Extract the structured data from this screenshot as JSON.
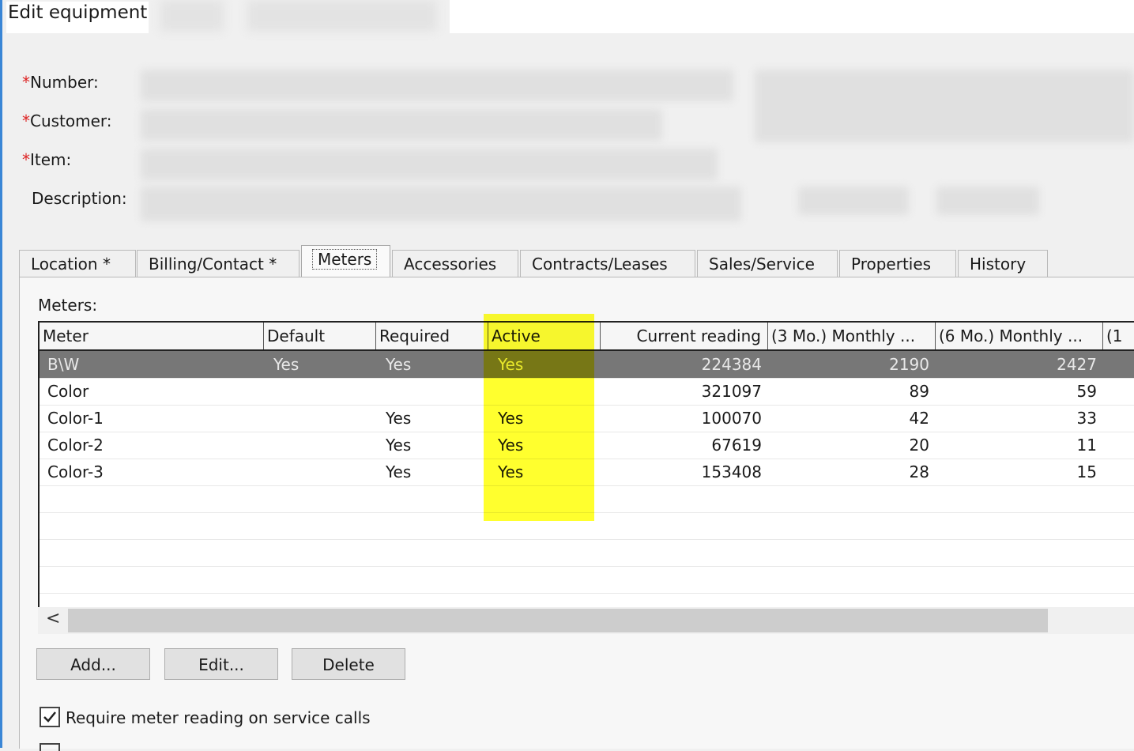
{
  "window": {
    "title": "Edit equipment"
  },
  "form": {
    "number_label": "Number:",
    "customer_label": "Customer:",
    "item_label": "Item:",
    "description_label": "Description:",
    "required_marker": "*"
  },
  "tabs": [
    {
      "label": "Location *",
      "active": false
    },
    {
      "label": "Billing/Contact *",
      "active": false
    },
    {
      "label": "Meters",
      "active": true
    },
    {
      "label": "Accessories",
      "active": false
    },
    {
      "label": "Contracts/Leases",
      "active": false
    },
    {
      "label": "Sales/Service",
      "active": false
    },
    {
      "label": "Properties",
      "active": false
    },
    {
      "label": "History",
      "active": false
    }
  ],
  "meters": {
    "section_label": "Meters:",
    "columns": [
      "Meter",
      "Default",
      "Required",
      "Active",
      "Current reading",
      "(3 Mo.) Monthly ...",
      "(6 Mo.) Monthly ...",
      "(1"
    ],
    "rows": [
      {
        "meter": "B\\W",
        "default": "Yes",
        "required": "Yes",
        "active": "Yes",
        "current": "224384",
        "mo3": "2190",
        "mo6": "2427",
        "selected": true
      },
      {
        "meter": "Color",
        "default": "",
        "required": "",
        "active": "",
        "current": "321097",
        "mo3": "89",
        "mo6": "59",
        "selected": false
      },
      {
        "meter": "Color-1",
        "default": "",
        "required": "Yes",
        "active": "Yes",
        "current": "100070",
        "mo3": "42",
        "mo6": "33",
        "selected": false
      },
      {
        "meter": "Color-2",
        "default": "",
        "required": "Yes",
        "active": "Yes",
        "current": "67619",
        "mo3": "20",
        "mo6": "11",
        "selected": false
      },
      {
        "meter": "Color-3",
        "default": "",
        "required": "Yes",
        "active": "Yes",
        "current": "153408",
        "mo3": "28",
        "mo6": "15",
        "selected": false
      }
    ],
    "scroll_left_glyph": "<",
    "highlight_color": "#ffff00"
  },
  "buttons": {
    "add": "Add...",
    "edit": "Edit...",
    "delete": "Delete"
  },
  "options": {
    "require_reading_label": "Require meter reading on service calls",
    "require_reading_checked": true
  }
}
